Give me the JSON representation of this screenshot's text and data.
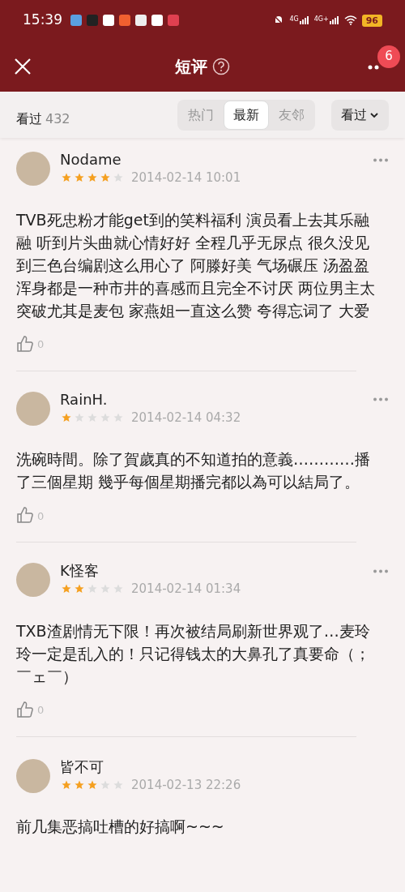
{
  "status_bar": {
    "time": "15:39",
    "network_labels": [
      "4G",
      "4G+"
    ],
    "battery": "96"
  },
  "nav": {
    "title": "短评",
    "badge": "6"
  },
  "filter_bar": {
    "count_label": "看过",
    "count": "432",
    "tabs": [
      {
        "label": "热门",
        "selected": false
      },
      {
        "label": "最新",
        "selected": true
      },
      {
        "label": "友邻",
        "selected": false
      }
    ],
    "dropdown": "看过"
  },
  "reviews": [
    {
      "user": "Nodame",
      "stars": 4,
      "date": "2014-02-14 10:01",
      "text": "TVB死忠粉才能get到的笑料福利 演员看上去其乐融融 听到片头曲就心情好好 全程几乎无尿点 很久没见到三色台编剧这么用心了 阿滕好美 气场碾压 汤盈盈浑身都是一种市井的喜感而且完全不讨厌 两位男主太突破尤其是麦包 家燕姐一直这么赞 夸得忘词了 大爱",
      "likes": "0"
    },
    {
      "user": "RainH.",
      "stars": 1,
      "date": "2014-02-14 04:32",
      "text": "洗碗時間。除了賀歲真的不知道拍的意義…………播了三個星期 幾乎每個星期播完都以為可以結局了。",
      "likes": "0"
    },
    {
      "user": "K怪客",
      "stars": 2,
      "date": "2014-02-14 01:34",
      "text": "TXB渣剧情无下限！再次被结局刷新世界观了…麦玲玲一定是乱入的！只记得钱太的大鼻孔了真要命（；￣ェ￣）",
      "likes": "0"
    },
    {
      "user": "皆不可",
      "stars": 3,
      "date": "2014-02-13 22:26",
      "text": "前几集恶搞吐槽的好搞啊~~~"
    }
  ]
}
